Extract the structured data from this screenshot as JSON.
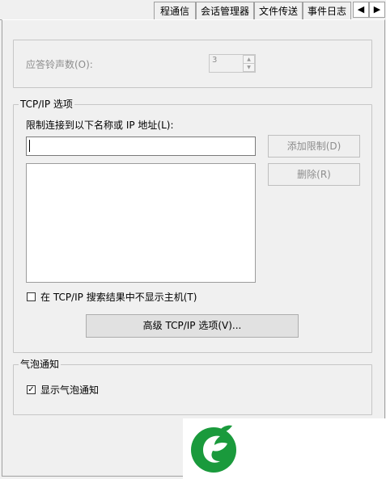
{
  "tabs": [
    {
      "label": "程通信"
    },
    {
      "label": "会话管理器"
    },
    {
      "label": "文件传送"
    },
    {
      "label": "事件日志"
    }
  ],
  "tab_scroll": {
    "left": "◀",
    "right": "▶"
  },
  "ring": {
    "label": "应答铃声数(O):",
    "value": "3"
  },
  "tcpip": {
    "group_label": "TCP/IP 选项",
    "restrict_label": "限制连接到以下名称或 IP 地址(L):",
    "input_value": "",
    "add_button": "添加限制(D)",
    "delete_button": "删除(R)",
    "hide_hosts_label": "在 TCP/IP 搜索结果中不显示主机(T)",
    "hide_hosts_checked": false,
    "advanced_button": "高级 TCP/IP 选项(V)..."
  },
  "bubble": {
    "group_label": "气泡通知",
    "show_label": "显示气泡通知",
    "show_checked": true
  },
  "colors": {
    "logo_green": "#1a9a3c"
  }
}
